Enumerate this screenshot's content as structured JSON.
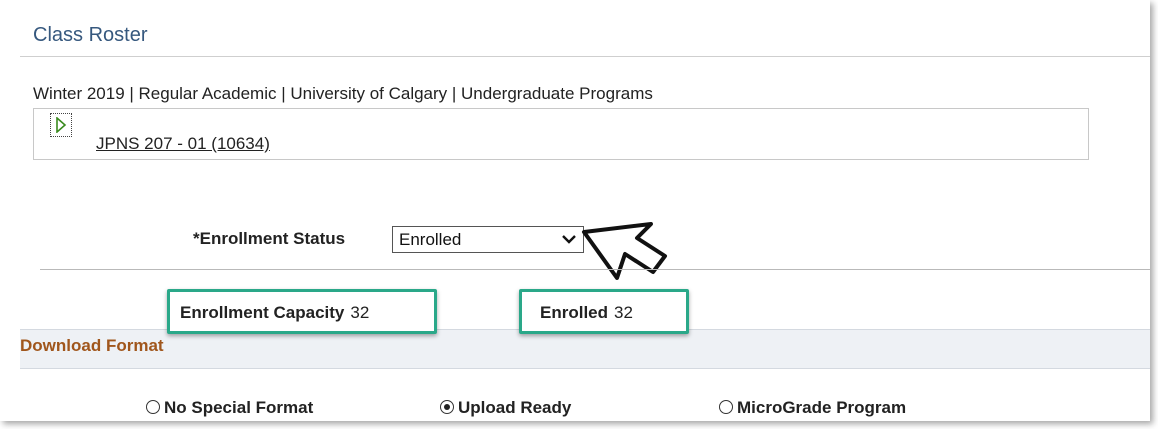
{
  "page": {
    "title": "Class Roster",
    "term_line": "Winter 2019 | Regular Academic | University of Calgary | Undergraduate Programs"
  },
  "class_section": {
    "link_label": "JPNS 207 - 01 (10634)",
    "expand_icon": "triangle-right-icon"
  },
  "enrollment_status": {
    "label": "*Enrollment Status",
    "selected": "Enrolled"
  },
  "stats": {
    "capacity_label": "Enrollment Capacity",
    "capacity_value": "32",
    "enrolled_label": "Enrolled",
    "enrolled_value": "32"
  },
  "download_format": {
    "title": "Download Format",
    "options": [
      {
        "label": "No Special Format",
        "selected": false
      },
      {
        "label": "Upload Ready",
        "selected": true
      },
      {
        "label": "MicroGrade Program",
        "selected": false
      }
    ]
  },
  "colors": {
    "title_blue": "#36587e",
    "highlight_green": "#2aa889",
    "section_orange": "#a0561c",
    "section_bg": "#eef1f5"
  }
}
